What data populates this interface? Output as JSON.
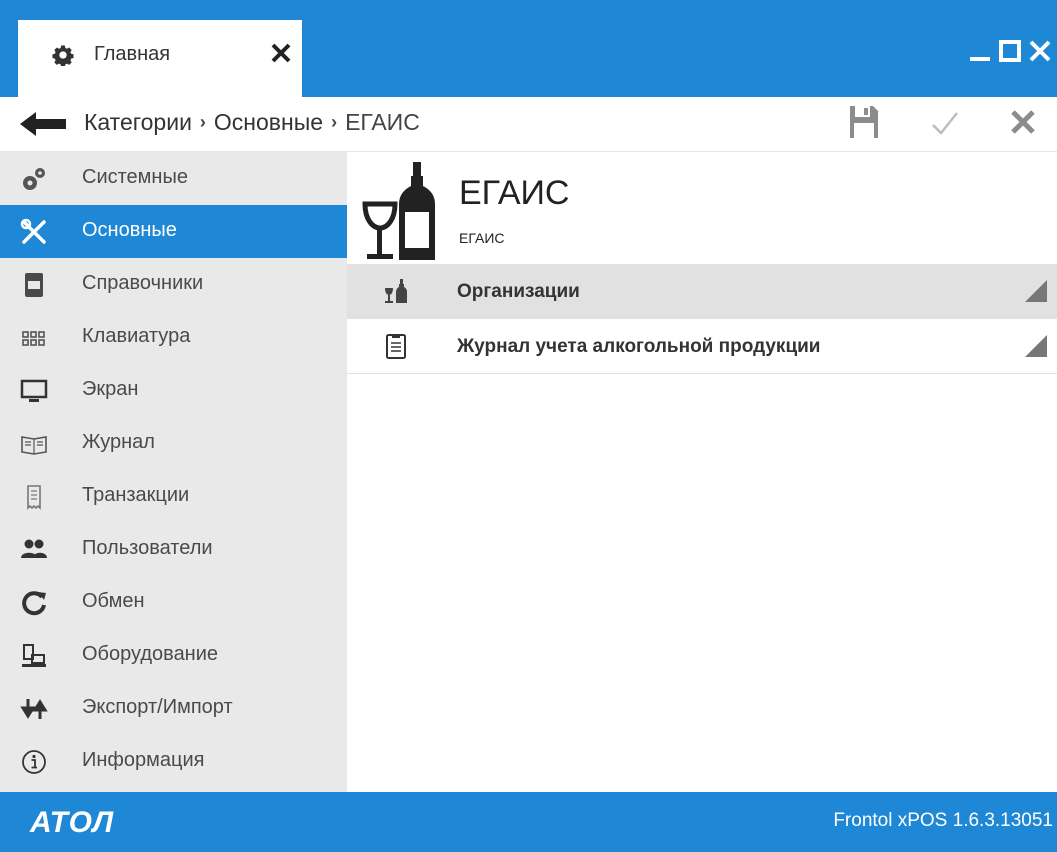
{
  "window": {
    "tab_label": "Главная",
    "tab_icon": "gear-icon",
    "controls": [
      "minimize-icon",
      "maximize-icon",
      "close-icon"
    ],
    "accent_color": "#1e88d6"
  },
  "breadcrumb": {
    "items": [
      "Категории",
      "Основные",
      "ЕГАИС"
    ],
    "separator": "›"
  },
  "toolbar": {
    "actions": [
      "save-icon",
      "check-icon",
      "cancel-icon"
    ]
  },
  "sidebar": {
    "items": [
      {
        "label": "Системные",
        "icon": "gears-icon",
        "active": false
      },
      {
        "label": "Основные",
        "icon": "tools-icon",
        "active": true
      },
      {
        "label": "Справочники",
        "icon": "reference-book-icon",
        "active": false
      },
      {
        "label": "Клавиатура",
        "icon": "keyboard-icon",
        "active": false
      },
      {
        "label": "Экран",
        "icon": "monitor-icon",
        "active": false
      },
      {
        "label": "Журнал",
        "icon": "journal-icon",
        "active": false
      },
      {
        "label": "Транзакции",
        "icon": "receipt-icon",
        "active": false
      },
      {
        "label": "Пользователи",
        "icon": "users-icon",
        "active": false
      },
      {
        "label": "Обмен",
        "icon": "sync-icon",
        "active": false
      },
      {
        "label": "Оборудование",
        "icon": "cash-register-icon",
        "active": false
      },
      {
        "label": "Экспорт/Импорт",
        "icon": "export-import-icon",
        "active": false
      },
      {
        "label": "Информация",
        "icon": "info-icon",
        "active": false
      }
    ]
  },
  "main": {
    "title": "ЕГАИС",
    "subtitle": "ЕГАИС",
    "header_icon": "wine-bottle-glass-icon",
    "rows": [
      {
        "label": "Организации",
        "icon": "wine-bottle-glass-icon",
        "selected": true
      },
      {
        "label": "Журнал учета алкогольной продукции",
        "icon": "clipboard-icon",
        "selected": false
      }
    ]
  },
  "statusbar": {
    "logo": "АТОЛ",
    "version": "Frontol xPOS 1.6.3.13051"
  }
}
